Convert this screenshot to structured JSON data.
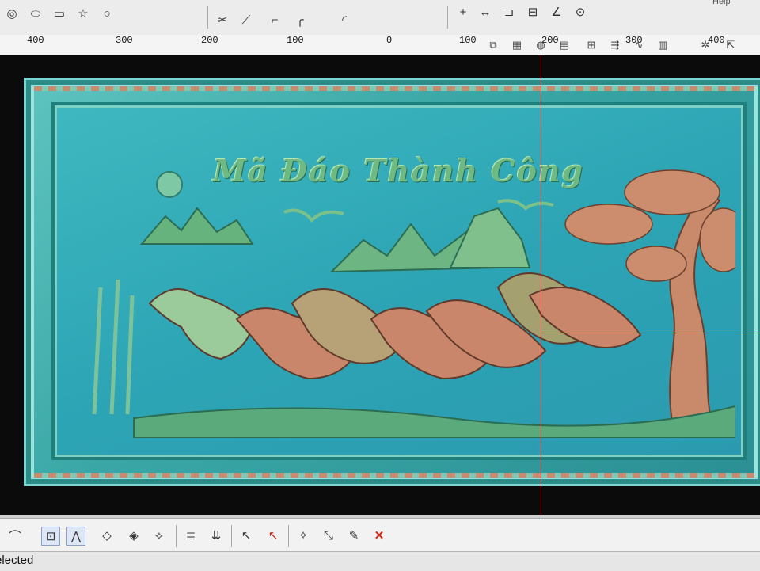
{
  "menu": {
    "fragment": "Help"
  },
  "toolbar_top": {
    "left_tools": [
      "circle-dot-icon",
      "ellipse-icon",
      "rectangle-icon",
      "star-icon",
      "circle-icon"
    ],
    "mid_tools": [
      "scissors-icon",
      "trim-icon",
      "corner-icon",
      "corner-round-icon",
      "arc-tool-icon"
    ],
    "right_tools": [
      "plus-icon",
      "dimension-icon",
      "offset-icon",
      "measure-icon",
      "angle-icon",
      "node-icon"
    ]
  },
  "ruler": {
    "labels": [
      "400",
      "300",
      "200",
      "100",
      "0",
      "100",
      "200",
      "300",
      "400"
    ],
    "tools_row": [
      "copy-icon",
      "array-icon",
      "revolve-icon",
      "extrude-icon",
      "mirror-icon",
      "align-icon",
      "wave-icon",
      "grid-icon",
      "gear-icon",
      "resize-icon"
    ]
  },
  "canvas": {
    "carved_title": "Mã Đáo Thành Công",
    "colors": {
      "relief_teal": "#3fb8c0",
      "relief_copper": "#d08a6a",
      "relief_green": "#6fba83",
      "crosshair": "#e0443a"
    }
  },
  "toolbar_bottom": {
    "tools": [
      "curve-icon",
      "select-node-icon",
      "select-tree-icon",
      "diamond-icon",
      "diamond-cross-icon",
      "diamond-x-icon",
      "layers-icon",
      "layers-up-icon",
      "pointer-plus-icon",
      "pointer-delete-icon",
      "transform-icon",
      "path-edit-icon",
      "edit-text-icon",
      "delete-icon"
    ]
  },
  "status": {
    "text": "elected"
  }
}
